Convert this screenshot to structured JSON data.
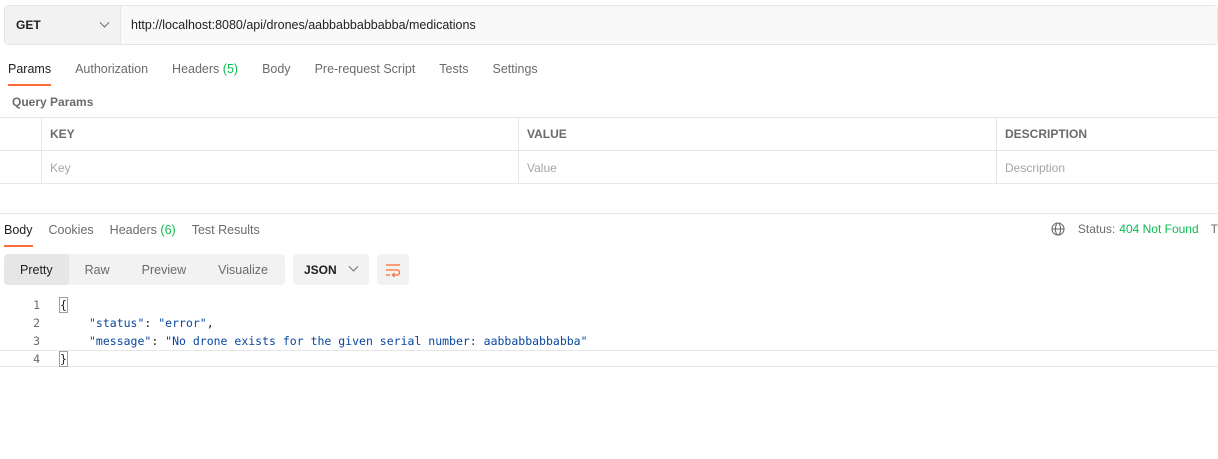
{
  "request": {
    "method": "GET",
    "url": "http://localhost:8080/api/drones/aabbabbabbabba/medications"
  },
  "request_tabs": [
    {
      "label": "Params",
      "count": ""
    },
    {
      "label": "Authorization",
      "count": ""
    },
    {
      "label": "Headers",
      "count": "(5)"
    },
    {
      "label": "Body",
      "count": ""
    },
    {
      "label": "Pre-request Script",
      "count": ""
    },
    {
      "label": "Tests",
      "count": ""
    },
    {
      "label": "Settings",
      "count": ""
    }
  ],
  "query_params": {
    "title": "Query Params",
    "columns": [
      "KEY",
      "VALUE",
      "DESCRIPTION"
    ],
    "placeholders": [
      "Key",
      "Value",
      "Description"
    ]
  },
  "response_tabs": [
    {
      "label": "Body",
      "count": ""
    },
    {
      "label": "Cookies",
      "count": ""
    },
    {
      "label": "Headers",
      "count": "(6)"
    },
    {
      "label": "Test Results",
      "count": ""
    }
  ],
  "status": {
    "label": "Status:",
    "value": "404 Not Found",
    "truncated_next": "T"
  },
  "format_buttons": [
    "Pretty",
    "Raw",
    "Preview",
    "Visualize"
  ],
  "language": "JSON",
  "code_lines": [
    {
      "num": "1",
      "text": "{"
    },
    {
      "num": "2",
      "key": "\"status\"",
      "sep": ": ",
      "value": "\"error\"",
      "trail": ","
    },
    {
      "num": "3",
      "key": "\"message\"",
      "sep": ": ",
      "value": "\"No drone exists for the given serial number: aabbabbabbabba\"",
      "trail": ""
    },
    {
      "num": "4",
      "text": "}"
    }
  ],
  "colors": {
    "accent": "#ff6c37",
    "success": "#0cbb52",
    "code_string": "#0a47a1"
  },
  "icons": {
    "globe": "globe-icon",
    "wrap": "wrap-lines-icon",
    "dropdown": "chevron-down-icon"
  }
}
